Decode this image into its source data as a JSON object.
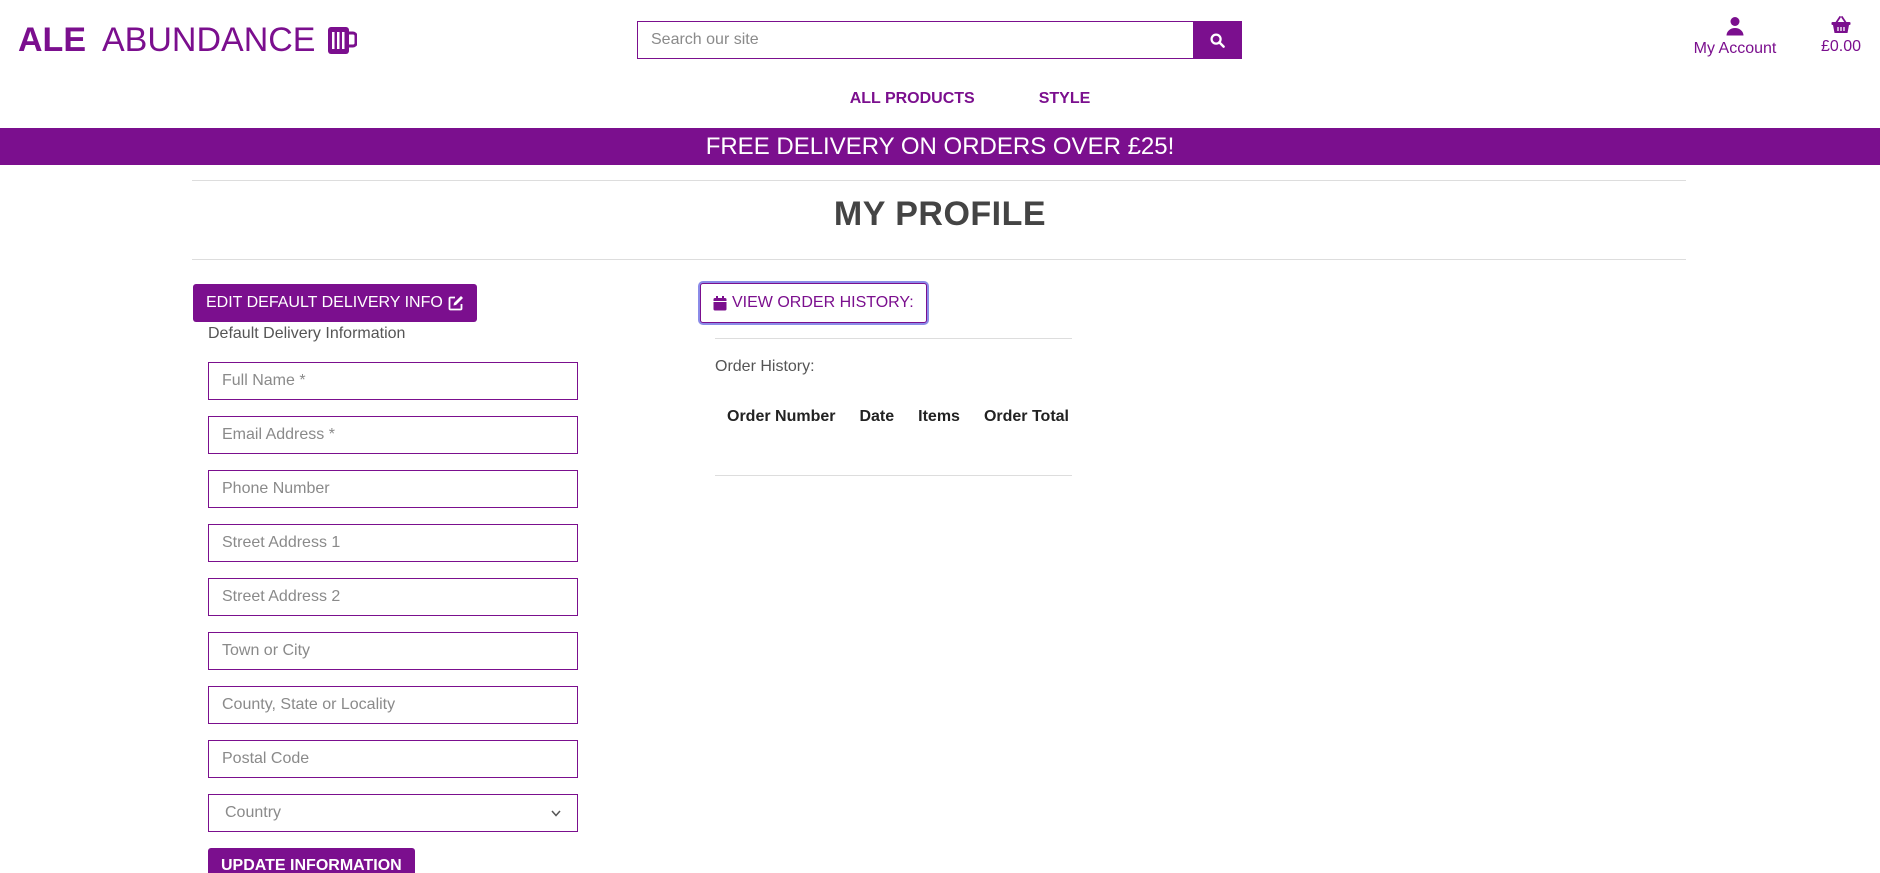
{
  "brand": {
    "bold": "ALE",
    "thin": "ABUNDANCE",
    "color": "#7b0f8e",
    "icon": "beer-mug-icon"
  },
  "search": {
    "placeholder": "Search our site",
    "button_icon": "search-icon"
  },
  "account": {
    "label": "My Account",
    "icon": "user-icon"
  },
  "basket": {
    "total": "£0.00",
    "icon": "basket-icon"
  },
  "nav": {
    "items": [
      "ALL PRODUCTS",
      "STYLE"
    ]
  },
  "banner": {
    "text": "FREE DELIVERY ON ORDERS OVER £25!"
  },
  "profile": {
    "title": "MY PROFILE",
    "edit_button": "EDIT DEFAULT DELIVERY INFO",
    "edit_icon": "edit-icon",
    "section_label": "Default Delivery Information",
    "fields": {
      "full_name": "Full Name *",
      "email": "Email Address *",
      "phone": "Phone Number",
      "street1": "Street Address 1",
      "street2": "Street Address 2",
      "town": "Town or City",
      "county": "County, State or Locality",
      "postcode": "Postal Code"
    },
    "country_select": "Country",
    "update_button": "UPDATE INFORMATION"
  },
  "history": {
    "button": "VIEW ORDER HISTORY:",
    "button_icon": "calendar-icon",
    "label": "Order History:",
    "columns": [
      "Order Number",
      "Date",
      "Items",
      "Order Total"
    ]
  }
}
